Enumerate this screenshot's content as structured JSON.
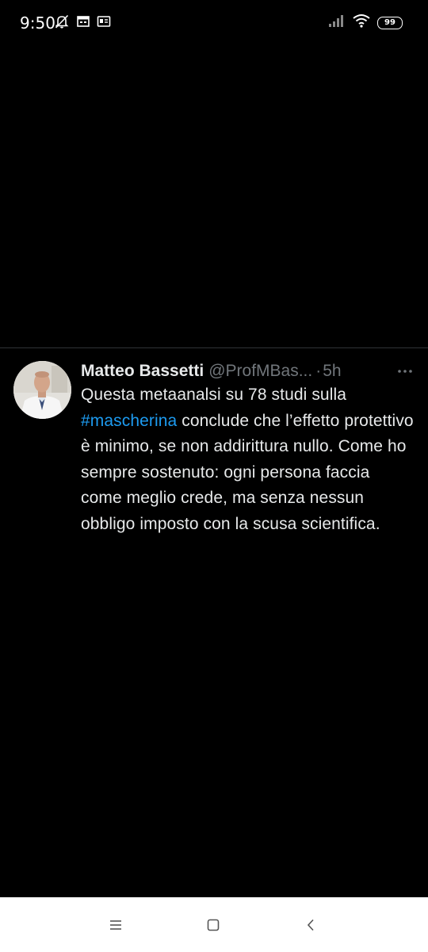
{
  "status_bar": {
    "time": "9:50",
    "battery": "99",
    "icons_left": [
      "notifications-off-icon",
      "calendar-icon",
      "news-icon"
    ],
    "icons_right": [
      "signal-icon",
      "wifi-icon",
      "battery-icon"
    ]
  },
  "tweet": {
    "display_name": "Matteo Bassetti",
    "handle": "@ProfMBas...",
    "separator": "·",
    "time_ago": "5h",
    "text_before": "Questa metaanalsi su 78 studi sulla ",
    "hashtag": "#mascherina",
    "text_after": " conclude che l’effetto protettivo è minimo, se non addirittura nullo. Come ho sempre sostenuto: ogni persona faccia come meglio crede, ma senza nessun obbligo imposto con la scusa scientifica.",
    "more_icon": "more-horizontal-icon",
    "hashtag_color": "#1d9bf0"
  },
  "nav_bar": {
    "buttons": [
      "menu-icon",
      "home-icon",
      "back-icon"
    ]
  }
}
